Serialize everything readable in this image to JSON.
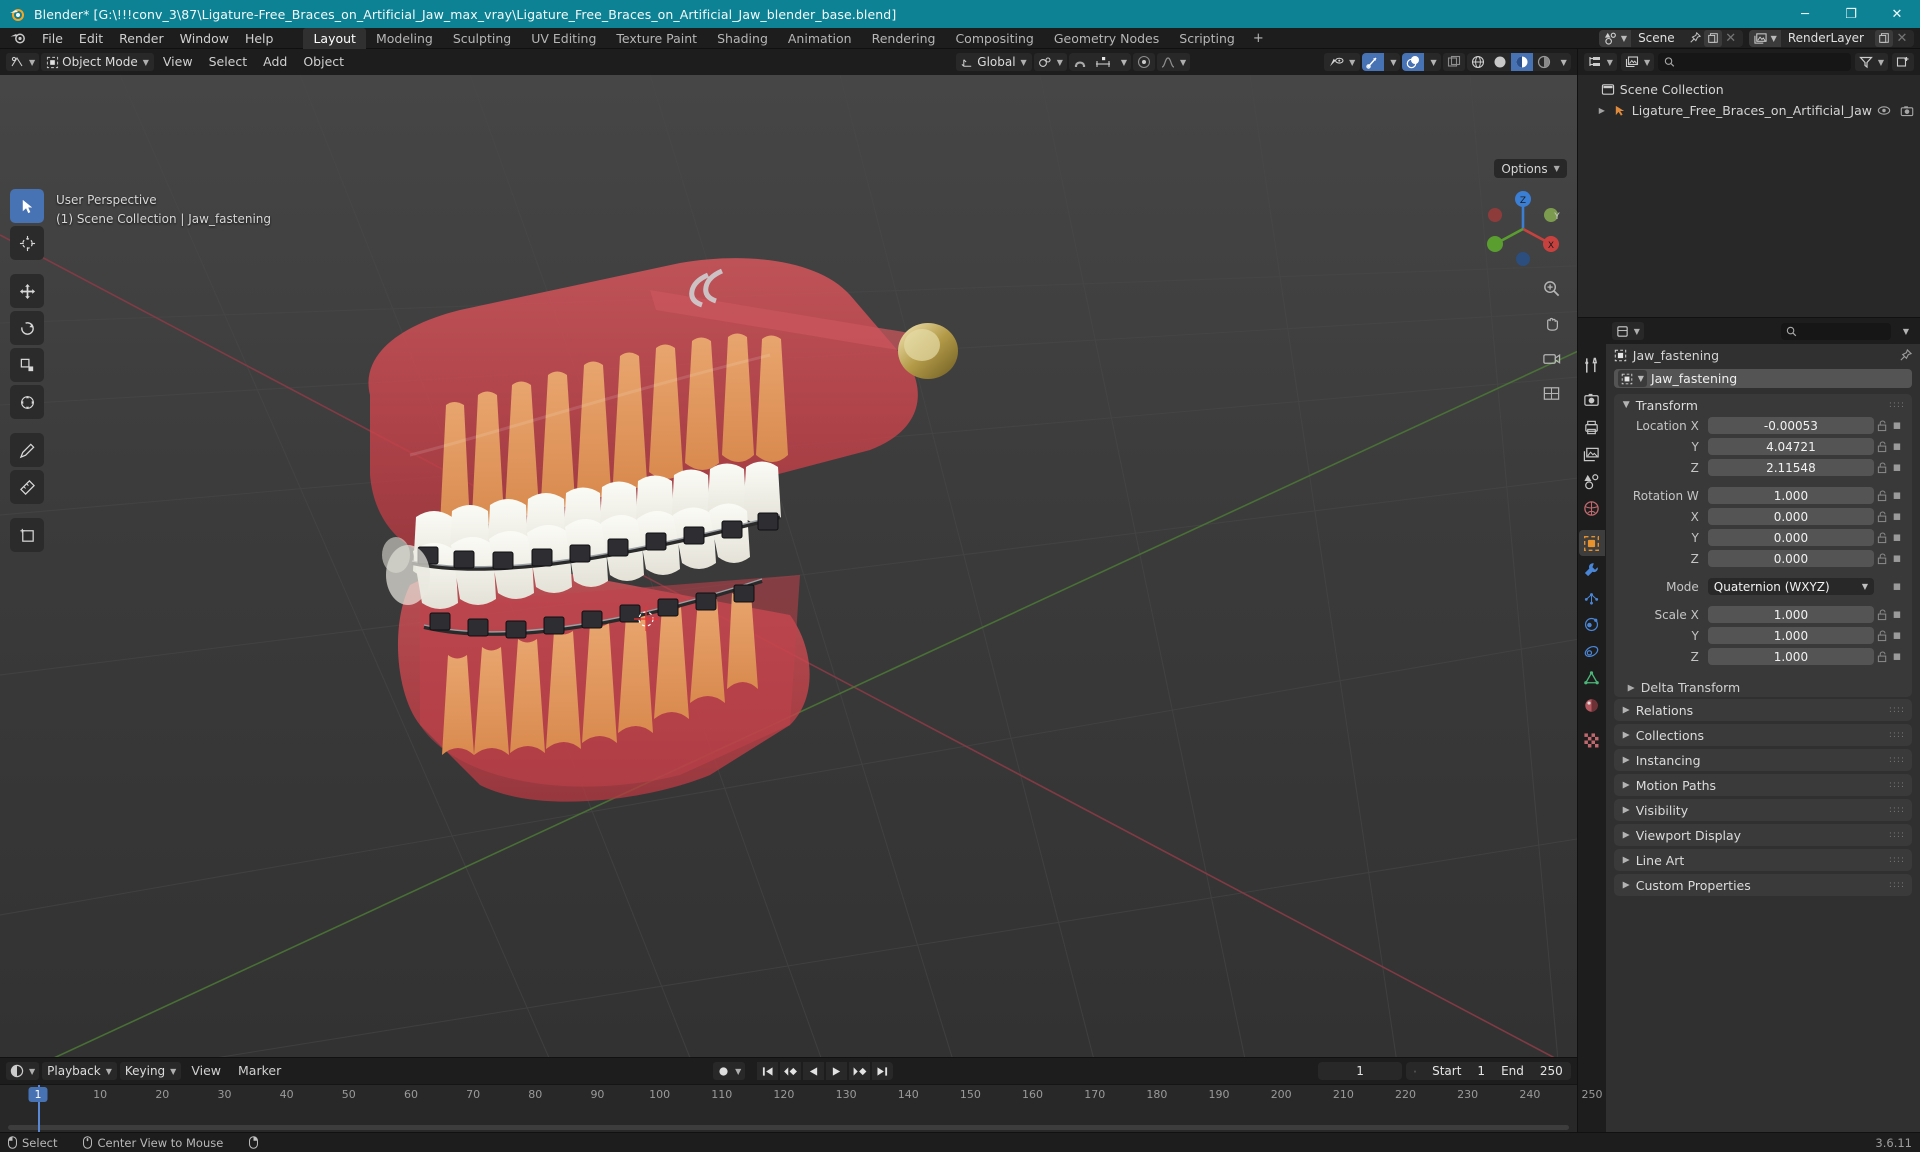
{
  "window": {
    "title": "Blender* [G:\\!!!conv_3\\87\\Ligature-Free_Braces_on_Artificial_Jaw_max_vray\\Ligature_Free_Braces_on_Artificial_Jaw_blender_base.blend]",
    "minimize": "─",
    "maximize": "❐",
    "close": "✕",
    "titlebar_color": "#0d8294"
  },
  "menubar": {
    "items": [
      "File",
      "Edit",
      "Render",
      "Window",
      "Help"
    ],
    "workspaces": [
      "Layout",
      "Modeling",
      "Sculpting",
      "UV Editing",
      "Texture Paint",
      "Shading",
      "Animation",
      "Rendering",
      "Compositing",
      "Geometry Nodes",
      "Scripting"
    ],
    "active_workspace": "Layout",
    "add_workspace": "+",
    "scene_name": "Scene",
    "viewlayer_name": "RenderLayer"
  },
  "viewport_header": {
    "mode": "Object Mode",
    "menus": [
      "View",
      "Select",
      "Add",
      "Object"
    ],
    "transform_orientation": "Global",
    "options_label": "Options"
  },
  "viewport": {
    "perspective": "User Perspective",
    "context": "(1) Scene Collection | Jaw_fastening",
    "gizmo_axes": [
      "X",
      "Y",
      "Z"
    ]
  },
  "outliner": {
    "search_placeholder": "",
    "rows": [
      {
        "label": "Scene Collection",
        "icon": "collection-icon",
        "depth": 0,
        "expandable": false
      },
      {
        "label": "Ligature_Free_Braces_on_Artificial_Jaw",
        "icon": "armature-icon",
        "depth": 1,
        "expandable": true
      }
    ]
  },
  "properties": {
    "search_placeholder": "",
    "breadcrumb": "Jaw_fastening",
    "object_name": "Jaw_fastening",
    "transform_panel": {
      "title": "Transform",
      "rows": [
        {
          "label": "Location X",
          "value": "-0.00053"
        },
        {
          "label": "Y",
          "value": "4.04721"
        },
        {
          "label": "Z",
          "value": "2.11548"
        },
        {
          "label": "Rotation W",
          "value": "1.000",
          "gap_before": true
        },
        {
          "label": "X",
          "value": "0.000"
        },
        {
          "label": "Y",
          "value": "0.000"
        },
        {
          "label": "Z",
          "value": "0.000"
        },
        {
          "label": "Mode",
          "value": "Quaternion (WXYZ)",
          "type": "select",
          "gap_before": true
        },
        {
          "label": "Scale X",
          "value": "1.000",
          "gap_before": true
        },
        {
          "label": "Y",
          "value": "1.000"
        },
        {
          "label": "Z",
          "value": "1.000"
        }
      ],
      "subpanel": "Delta Transform"
    },
    "closed_panels": [
      "Relations",
      "Collections",
      "Instancing",
      "Motion Paths",
      "Visibility",
      "Viewport Display",
      "Line Art",
      "Custom Properties"
    ]
  },
  "timeline": {
    "editor_menus": [
      "Playback",
      "Keying",
      "View",
      "Marker"
    ],
    "current_frame": "1",
    "start_label": "Start",
    "start_value": "1",
    "end_label": "End",
    "end_value": "250",
    "ticks": [
      "1",
      "10",
      "20",
      "30",
      "40",
      "50",
      "60",
      "70",
      "80",
      "90",
      "100",
      "110",
      "120",
      "130",
      "140",
      "150",
      "160",
      "170",
      "180",
      "190",
      "200",
      "210",
      "220",
      "230",
      "240",
      "250"
    ],
    "playhead_label": "1"
  },
  "statusbar": {
    "left_items": [
      {
        "icon": "mouse-left-icon",
        "label": "Select"
      },
      {
        "icon": "mouse-middle-icon",
        "label": "Center View to Mouse"
      },
      {
        "icon": "mouse-right-icon",
        "label": ""
      }
    ],
    "version": "3.6.11"
  },
  "colors": {
    "accent_blue": "#4772b3",
    "panel_bg": "#303030",
    "header_bg": "#1d1d1d",
    "field_bg": "#545454",
    "viewport_bg": "#3b3b3b"
  }
}
